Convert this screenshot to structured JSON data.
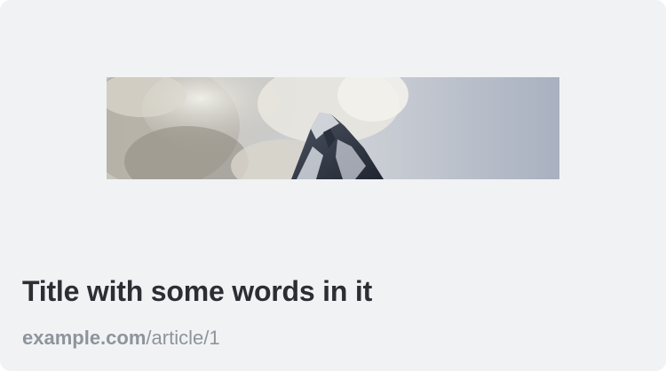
{
  "link_preview": {
    "image_alt": "Snow-capped mountain peak among clouds",
    "title": "Title with some words in it",
    "domain": "example.com",
    "path": "/article/1"
  },
  "colors": {
    "card_background": "#f1f2f4",
    "title": "#2b2e33",
    "url": "#8d949c"
  }
}
